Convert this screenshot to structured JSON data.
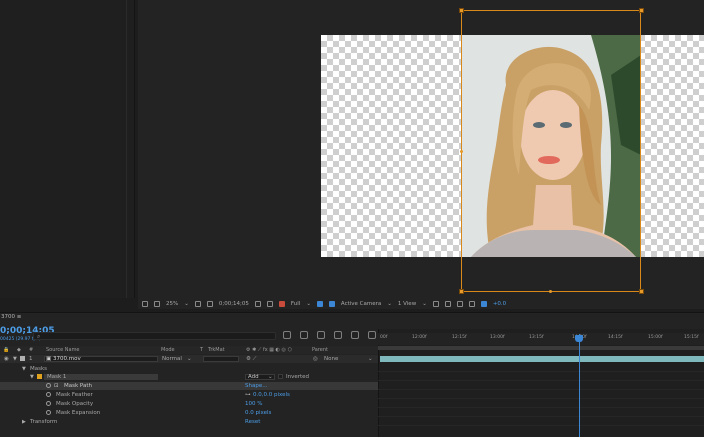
{
  "viewer": {
    "zoom": "25%",
    "timecode": "0;00;14;05",
    "resolution": "Full",
    "camera": "Active Camera",
    "view": "1 View",
    "offset": "+0.0"
  },
  "timeline": {
    "comp_name": "3700",
    "timecode": "0;00;14;05",
    "fps": "00425 (29.97 fps)",
    "columns": {
      "source_name": "Source Name",
      "mode": "Mode",
      "t": "T",
      "trkmat": "TrkMat",
      "parent": "Parent"
    },
    "layer": {
      "index": "1",
      "name": "3700.mov",
      "mode": "Normal",
      "parent": "None"
    },
    "masks_label": "Masks",
    "mask1": {
      "name": "Mask 1",
      "mode": "Add",
      "inverted": "Inverted"
    },
    "mask_path": {
      "label": "Mask Path",
      "value": "Shape..."
    },
    "mask_feather": {
      "label": "Mask Feather",
      "value": "0.0,0.0 pixels"
    },
    "mask_opacity": {
      "label": "Mask Opacity",
      "value": "100 %"
    },
    "mask_expansion": {
      "label": "Mask Expansion",
      "value": "0.0 pixels"
    },
    "transform": {
      "label": "Transform",
      "value": "Reset"
    },
    "ruler_ticks": [
      "00f",
      "12:00f",
      "12:15f",
      "13:00f",
      "13:15f",
      "14:00f",
      "14:15f",
      "15:00f",
      "15:15f"
    ]
  },
  "colors": {
    "accent_blue": "#4d9ee8",
    "layer_orange": "#d9891a",
    "layer_bar": "#7fb8bd"
  }
}
